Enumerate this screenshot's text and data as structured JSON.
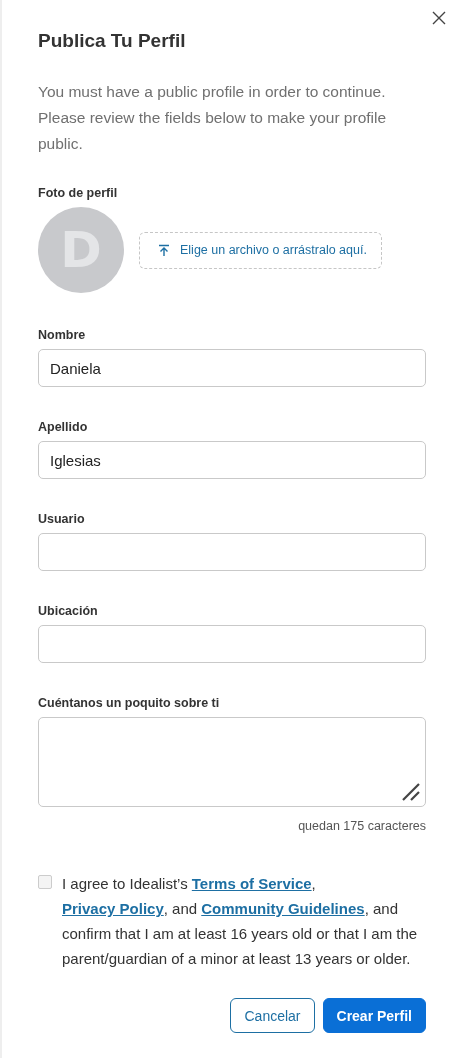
{
  "dialog": {
    "title": "Publica Tu Perfil",
    "description": "You must have a public profile in order to continue. Please review the fields below to make your profile public."
  },
  "photo": {
    "label": "Foto de perfil",
    "initial": "D",
    "upload": "Elige un archivo o arrástralo aquí."
  },
  "fields": [
    {
      "kind": "input",
      "label": "Nombre",
      "value": "Daniela"
    },
    {
      "kind": "input",
      "label": "Apellido",
      "value": "Iglesias"
    },
    {
      "kind": "input",
      "label": "Usuario"
    },
    {
      "kind": "input",
      "label": "Ubicación"
    },
    {
      "kind": "textarea",
      "label": "Cuéntanos un poquito sobre ti",
      "counter": "quedan 175 caracteres"
    }
  ],
  "agreement": {
    "checked": false,
    "parts": [
      {
        "kind": "text",
        "text": "I agree to Idealist’s "
      },
      {
        "kind": "link",
        "text": "Terms of Service"
      },
      {
        "kind": "text",
        "text": ", "
      },
      {
        "kind": "link",
        "text": "Privacy Policy"
      },
      {
        "kind": "text",
        "text": ", and "
      },
      {
        "kind": "link",
        "text": "Community Guidelines"
      },
      {
        "kind": "text",
        "text": ", and confirm that I am at least 16 years old or that I am the parent/guardian of a minor at least 13 years or older."
      }
    ]
  },
  "buttons": [
    {
      "kind": "secondary",
      "label": "Cancelar"
    },
    {
      "kind": "primary",
      "label": "Crear Perfil"
    }
  ]
}
